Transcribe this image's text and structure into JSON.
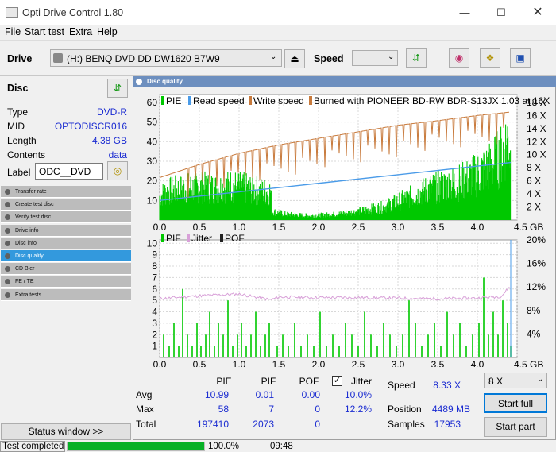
{
  "app": {
    "title": "Opti Drive Control 1.80"
  },
  "menu": [
    "File",
    "Start test",
    "Extra",
    "Help"
  ],
  "toolbar": {
    "drive_label": "Drive",
    "drive_value": "(H:)   BENQ DVD DD DW1620 B7W9",
    "speed_label": "Speed",
    "speed_value": ""
  },
  "disc": {
    "heading": "Disc",
    "rows": [
      {
        "label": "Type",
        "value": "DVD-R"
      },
      {
        "label": "MID",
        "value": "OPTODISCR016"
      },
      {
        "label": "Length",
        "value": "4.38 GB"
      },
      {
        "label": "Contents",
        "value": "data"
      }
    ],
    "label_label": "Label",
    "label_value": "ODC__DVD"
  },
  "nav": [
    {
      "label": "Transfer rate",
      "selected": false
    },
    {
      "label": "Create test disc",
      "selected": false
    },
    {
      "label": "Verify test disc",
      "selected": false
    },
    {
      "label": "Drive info",
      "selected": false
    },
    {
      "label": "Disc info",
      "selected": false
    },
    {
      "label": "Disc quality",
      "selected": true
    },
    {
      "label": "CD Bler",
      "selected": false
    },
    {
      "label": "FE / TE",
      "selected": false
    },
    {
      "label": "Extra tests",
      "selected": false
    }
  ],
  "status_window_button": "Status window >>",
  "panel_title": "Disc quality",
  "chart_data": [
    {
      "type": "area",
      "legend": [
        "PIE",
        "Read speed",
        "Write speed",
        "Burned with PIONEER BD-RW   BDR-S13JX 1.03 at 16X"
      ],
      "x_ticks": [
        "0.0",
        "0.5",
        "1.0",
        "1.5",
        "2.0",
        "2.5",
        "3.0",
        "3.5",
        "4.0",
        "4.5 GB"
      ],
      "y_left_ticks": [
        "60",
        "50",
        "40",
        "30",
        "20",
        "10"
      ],
      "y_right_ticks": [
        "18 X",
        "16 X",
        "14 X",
        "12 X",
        "10 X",
        "8 X",
        "6 X",
        "4 X",
        "2 X"
      ],
      "ylim": [
        0,
        64
      ],
      "xlim": [
        0,
        4.5
      ],
      "colors": {
        "pie": "#00c800",
        "read": "#4a9be8",
        "write": "#c87a3c"
      },
      "pie_envelope": {
        "x": [
          0.0,
          0.1,
          0.3,
          0.5,
          0.7,
          0.9,
          1.1,
          1.3,
          1.4,
          1.41,
          1.6,
          1.9,
          2.2,
          2.5,
          2.8,
          3.0,
          3.2,
          3.4,
          3.6,
          3.8,
          4.0,
          4.2,
          4.3,
          4.35,
          4.4,
          4.42
        ],
        "y": [
          17,
          20,
          22,
          23,
          22,
          24,
          22,
          20,
          20,
          6,
          4,
          3,
          4,
          6,
          9,
          13,
          17,
          22,
          24,
          27,
          32,
          39,
          45,
          52,
          58,
          40
        ]
      },
      "read_speed": {
        "x": [
          0.0,
          4.42
        ],
        "y": [
          3.0,
          8.8
        ]
      },
      "write_speed": {
        "x": [
          0.0,
          0.5,
          1.0,
          1.5,
          2.0,
          2.5,
          3.0,
          3.5,
          4.0,
          4.4
        ],
        "y": [
          6.5,
          8.5,
          10.2,
          11.5,
          12.5,
          13.5,
          14.5,
          15.2,
          16.0,
          16.5
        ]
      }
    },
    {
      "type": "bar",
      "legend": [
        "PIF",
        "Jitter",
        "POF"
      ],
      "x_ticks": [
        "0.0",
        "0.5",
        "1.0",
        "1.5",
        "2.0",
        "2.5",
        "3.0",
        "3.5",
        "4.0",
        "4.5 GB"
      ],
      "y_left_ticks": [
        "10",
        "9",
        "8",
        "7",
        "6",
        "5",
        "4",
        "3",
        "2",
        "1"
      ],
      "y_right_ticks": [
        "20%",
        "16%",
        "12%",
        "8%",
        "4%"
      ],
      "ylim": [
        0,
        10
      ],
      "colors": {
        "pif": "#00c800",
        "jitter": "#d8a0d8"
      },
      "pif_spikes": {
        "x": [
          0.05,
          0.12,
          0.18,
          0.24,
          0.29,
          0.35,
          0.41,
          0.47,
          0.52,
          0.58,
          0.63,
          0.69,
          0.74,
          0.8,
          0.86,
          0.92,
          0.98,
          1.03,
          1.09,
          1.15,
          1.21,
          1.27,
          1.33,
          1.38,
          1.48,
          1.55,
          1.62,
          1.7,
          1.78,
          1.86,
          1.94,
          2.02,
          2.1,
          2.18,
          2.26,
          2.34,
          2.42,
          2.5,
          2.58,
          2.66,
          2.74,
          2.82,
          2.9,
          2.98,
          3.06,
          3.14,
          3.22,
          3.3,
          3.38,
          3.46,
          3.54,
          3.62,
          3.7,
          3.78,
          3.86,
          3.94,
          4.02,
          4.08,
          4.14,
          4.2,
          4.26,
          4.32,
          4.38,
          4.42
        ],
        "y": [
          2,
          1,
          3,
          1,
          6,
          2,
          1,
          3,
          1,
          2,
          4,
          1,
          3,
          2,
          5,
          1,
          2,
          3,
          1,
          2,
          4,
          1,
          2,
          3,
          1,
          2,
          1,
          3,
          1,
          2,
          1,
          4,
          1,
          2,
          1,
          3,
          2,
          1,
          4,
          2,
          1,
          3,
          2,
          1,
          2,
          5,
          3,
          1,
          2,
          3,
          1,
          4,
          2,
          3,
          1,
          2,
          3,
          7,
          2,
          4,
          2,
          5,
          3,
          1
        ]
      },
      "jitter_pct": {
        "x": [
          0.0,
          0.5,
          1.0,
          1.4,
          1.5,
          2.0,
          2.5,
          3.0,
          3.5,
          4.0,
          4.3,
          4.42
        ],
        "y": [
          10.0,
          10.5,
          10.8,
          9.8,
          10.3,
          10.2,
          10.2,
          10.1,
          10.0,
          10.1,
          10.4,
          12.2
        ]
      }
    }
  ],
  "stats": {
    "headers": [
      "PIE",
      "PIF",
      "POF",
      "Jitter"
    ],
    "jitter_checked": true,
    "rows": [
      {
        "label": "Avg",
        "values": [
          "10.99",
          "0.01",
          "0.00",
          "10.0%"
        ]
      },
      {
        "label": "Max",
        "values": [
          "58",
          "7",
          "0",
          "12.2%"
        ]
      },
      {
        "label": "Total",
        "values": [
          "197410",
          "2073",
          "0",
          ""
        ]
      }
    ],
    "speed_label": "Speed",
    "speed_value": "8.33 X",
    "position_label": "Position",
    "position_value": "4489 MB",
    "samples_label": "Samples",
    "samples_value": "17953",
    "speed_select": "8 X",
    "start_full": "Start full",
    "start_part": "Start part"
  },
  "status": {
    "text": "Test completed",
    "progress_pct": 100.0,
    "progress_label": "100.0%",
    "time": "09:48"
  }
}
